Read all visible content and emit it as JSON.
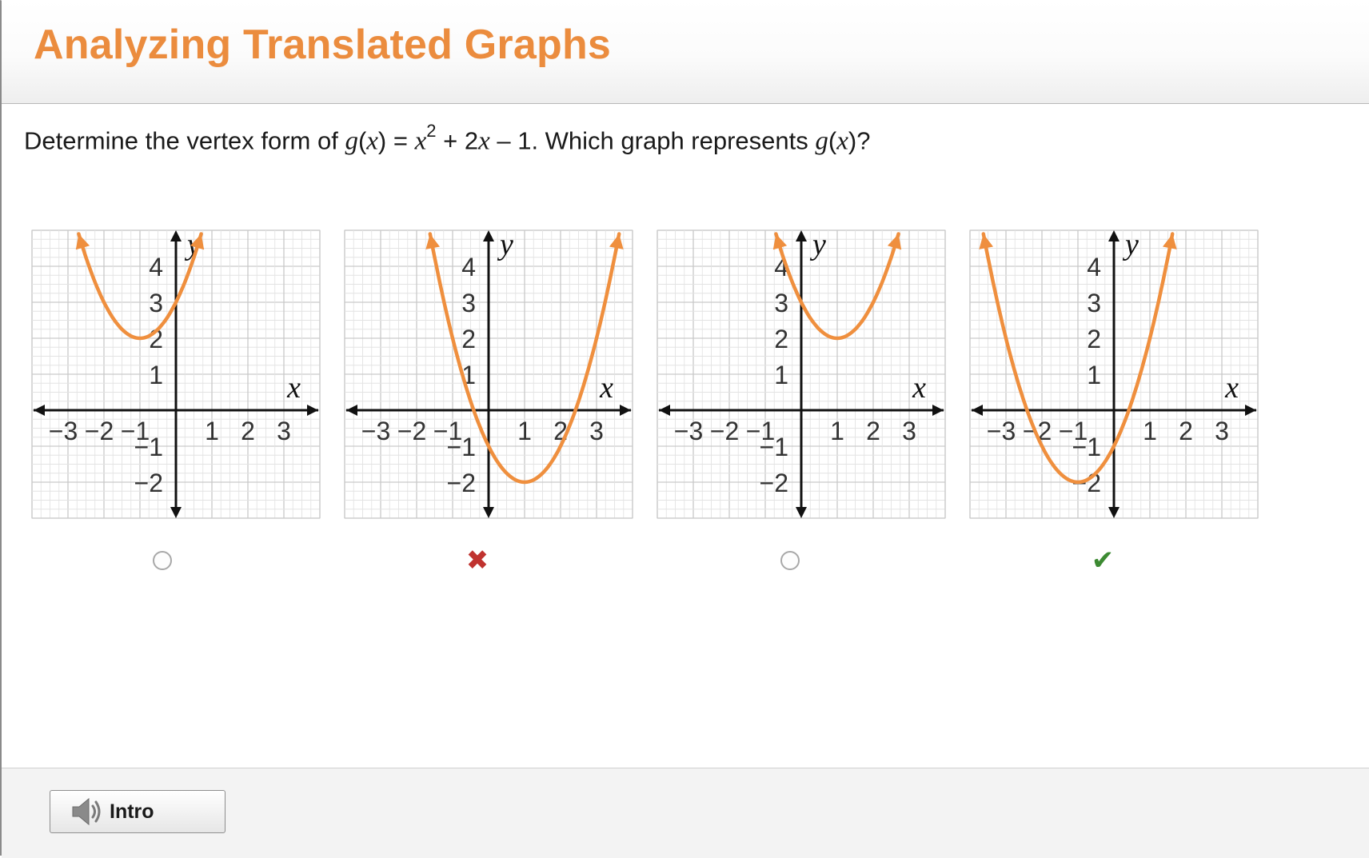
{
  "header": {
    "title": "Analyzing Translated Graphs"
  },
  "question": {
    "prefix": "Determine the vertex form of ",
    "g": "g",
    "open": "(",
    "xvar": "x",
    "close": ")",
    "eq": " = ",
    "x2": "x",
    "exp": "2",
    "mid": " + 2",
    "xvar2": "x",
    "tail": " – 1. Which graph represents ",
    "g2": "g",
    "open2": "(",
    "xvar3": "x",
    "close2": ")?"
  },
  "graph_labels": {
    "x_axis": "x",
    "y_axis": "y",
    "x_ticks": [
      "−3",
      "−2",
      "−1",
      "1",
      "2",
      "3"
    ],
    "y_ticks": [
      "4",
      "3",
      "2",
      "1",
      "−1",
      "−2"
    ]
  },
  "chart_data": [
    {
      "type": "line",
      "option": 1,
      "function": "y = (x+1)^2 + 2",
      "vertex": [
        -1,
        2
      ],
      "xlim": [
        -4,
        4
      ],
      "ylim": [
        -3,
        5
      ],
      "color": "#ef8f3e",
      "status": "unselected"
    },
    {
      "type": "line",
      "option": 2,
      "function": "y = (x-1)^2 - 2",
      "vertex": [
        1,
        -2
      ],
      "xlim": [
        -4,
        4
      ],
      "ylim": [
        -3,
        5
      ],
      "color": "#ef8f3e",
      "status": "incorrect"
    },
    {
      "type": "line",
      "option": 3,
      "function": "y = (x-1)^2 + 2",
      "vertex": [
        1,
        2
      ],
      "xlim": [
        -4,
        4
      ],
      "ylim": [
        -3,
        5
      ],
      "color": "#ef8f3e",
      "status": "unselected"
    },
    {
      "type": "line",
      "option": 4,
      "function": "y = (x+1)^2 - 2",
      "vertex": [
        -1,
        -2
      ],
      "xlim": [
        -4,
        4
      ],
      "ylim": [
        -3,
        5
      ],
      "color": "#ef8f3e",
      "status": "correct"
    }
  ],
  "choices": [
    {
      "state": "radio"
    },
    {
      "state": "incorrect",
      "symbol": "✖"
    },
    {
      "state": "radio"
    },
    {
      "state": "correct",
      "symbol": "✔"
    }
  ],
  "footer": {
    "intro_label": "Intro",
    "intro_icon": "speaker-icon"
  },
  "colors": {
    "title": "#eb8c3e",
    "curve": "#ef8f3e",
    "incorrect": "#c0332f",
    "correct": "#3c8a32"
  }
}
